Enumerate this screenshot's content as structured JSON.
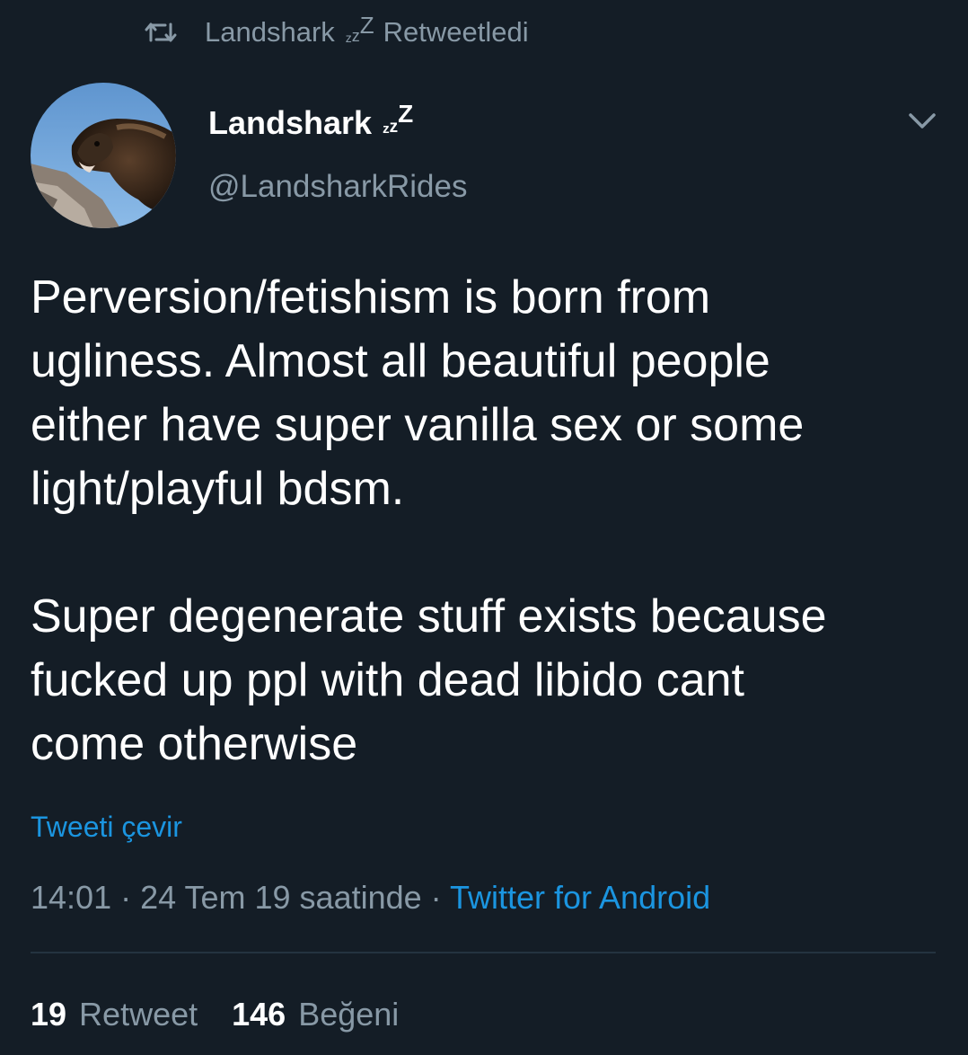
{
  "retweet_banner": {
    "icon": "retweet-icon",
    "user": "Landshark",
    "sleep_emoji": [
      "z",
      "z",
      "Z"
    ],
    "action": "Retweetledi"
  },
  "author": {
    "display_name": "Landshark",
    "sleep_emoji": [
      "z",
      "z",
      "Z"
    ],
    "handle": "@LandsharkRides",
    "avatar": "wolverine-photo"
  },
  "menu_icon": "chevron-down-icon",
  "tweet": {
    "paragraph1_lines": [
      "Perversion/fetishism is born from",
      "ugliness. Almost all beautiful people",
      "either have super vanilla sex or some",
      "light/playful bdsm."
    ],
    "paragraph2_lines": [
      "Super degenerate stuff exists because",
      "fucked up ppl with dead libido cant",
      "come otherwise"
    ]
  },
  "translate_label": "Tweeti çevir",
  "meta": {
    "time": "14:01",
    "separator": " · ",
    "date": "24 Tem 19 saatinde",
    "source": "Twitter for Android"
  },
  "stats": {
    "retweets_count": "19",
    "retweets_label": "Retweet",
    "likes_count": "146",
    "likes_label": "Beğeni"
  },
  "colors": {
    "background": "#141d26",
    "secondary_text": "#8899a6",
    "link": "#1b95e0",
    "divider": "#243340"
  }
}
